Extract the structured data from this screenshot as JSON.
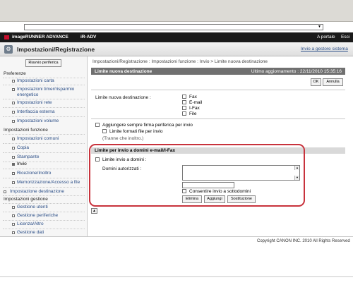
{
  "canon_bar": {
    "product": "imageRUNNER ADVANCE",
    "model": "iR-ADV",
    "portal": "A portale",
    "logout": "Esci"
  },
  "title": {
    "text": "Impostazioni/Registrazione",
    "to_home": "Invio a gestore sistema"
  },
  "sidebar": {
    "restart": "Riavvio periferica",
    "sections": {
      "pref": "Preferenze",
      "func": "Impostazioni funzione",
      "dest": "Impostazione destinazione",
      "mgmt": "Impostazioni gestione"
    },
    "items": {
      "carta": "Impostazioni carta",
      "timer": "Impostazioni timer/risparmio energetico",
      "rete": "Impostazioni rete",
      "interfaccia": "Interfaccia esterna",
      "volume": "Impostazioni volume",
      "comuni": "Impostazioni comuni",
      "copia": "Copia",
      "stampante": "Stampante",
      "invio": "Invio",
      "ricezione": "Ricezione/Inoltro",
      "memorizzazione": "Memorizzazione/Accesso a file",
      "utenti": "Gestione utenti",
      "periferiche": "Gestione periferiche",
      "licenza": "Licenza/Altro",
      "dati": "Gestione dati"
    }
  },
  "main": {
    "breadcrumb": "Impostazioni/Registrazione : Impostazioni funzione : Invio > Limite nuova destinazione",
    "header_title": "Limite nuova destinazione",
    "last_update": "Ultimo aggiornamento : 22/11/2010 15:35:16",
    "ok": "OK",
    "cancel": "Annulla",
    "new_dest_label": "Limite nuova destinazione :",
    "options": {
      "fax": "Fax",
      "email": "E-mail",
      "ifax": "I-Fax",
      "file": "File"
    },
    "add_signature": "Aggiungere sempre firma periferica per invio",
    "limit_formats": "Limite formati file per invio",
    "forward_note": "(Tranne che inoltro.)",
    "section_title": "Limite per invio a domini e-mail/I-Fax",
    "limit_domains": "Limite invio a domini :",
    "allowed_domains": "Domini autorizzati :",
    "allowed_domains_value": "",
    "domain_input_value": "",
    "allow_subdomains": "Consentire invio a sottodomini",
    "delete": "Elimina",
    "add": "Aggiungi",
    "replace": "Sostituzione"
  },
  "footer": {
    "copyright": "Copyright CANON INC. 2010 All Rights Reserved"
  }
}
